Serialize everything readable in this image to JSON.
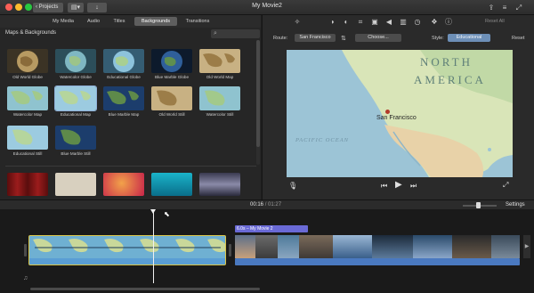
{
  "titlebar": {
    "projects_label": "‹ Projects",
    "title": "My Movie2",
    "icons": [
      "filmstrip-icon",
      "import-arrow-icon",
      "share-icon",
      "menu-icon",
      "fullscreen-icon"
    ]
  },
  "tabs": [
    {
      "label": "My Media",
      "active": false
    },
    {
      "label": "Audio",
      "active": false
    },
    {
      "label": "Titles",
      "active": false
    },
    {
      "label": "Backgrounds",
      "active": true
    },
    {
      "label": "Transitions",
      "active": false
    }
  ],
  "browser": {
    "section_title": "Maps & Backgrounds",
    "search_placeholder": "",
    "tiles": [
      {
        "label": "Old World Globe"
      },
      {
        "label": "Watercolor Globe"
      },
      {
        "label": "Educational Globe"
      },
      {
        "label": "Blue Marble Globe"
      },
      {
        "label": "Old World Map"
      },
      {
        "label": "Watercolor Map"
      },
      {
        "label": "Educational Map"
      },
      {
        "label": "Blue Marble Map"
      },
      {
        "label": "Old World Still"
      },
      {
        "label": "Watercolor Still"
      },
      {
        "label": "Educational Still"
      },
      {
        "label": "Blue Marble Still"
      }
    ]
  },
  "viewer": {
    "reset_all": "Reset All",
    "route_label": "Route:",
    "route_from": "San Francisco",
    "route_to": "Choose...",
    "style_label": "Style:",
    "style_value": "Educational",
    "reset": "Reset",
    "map": {
      "region_line1": "NORTH",
      "region_line2": "AMERICA",
      "ocean": "PACIFIC OCEAN",
      "city": "San Francisco"
    }
  },
  "timeline": {
    "timecode_current": "00:16",
    "timecode_separator": "/",
    "timecode_total": "01:27",
    "settings": "Settings",
    "title_clip": "6.0s – My Movie 2"
  },
  "colors": {
    "accent_blue": "#6d8fb7",
    "clip_selection": "#d9c54a",
    "audio_blue": "#4a79c0",
    "title_purple": "#6a6ad6",
    "city_dot": "#b23a2a"
  }
}
